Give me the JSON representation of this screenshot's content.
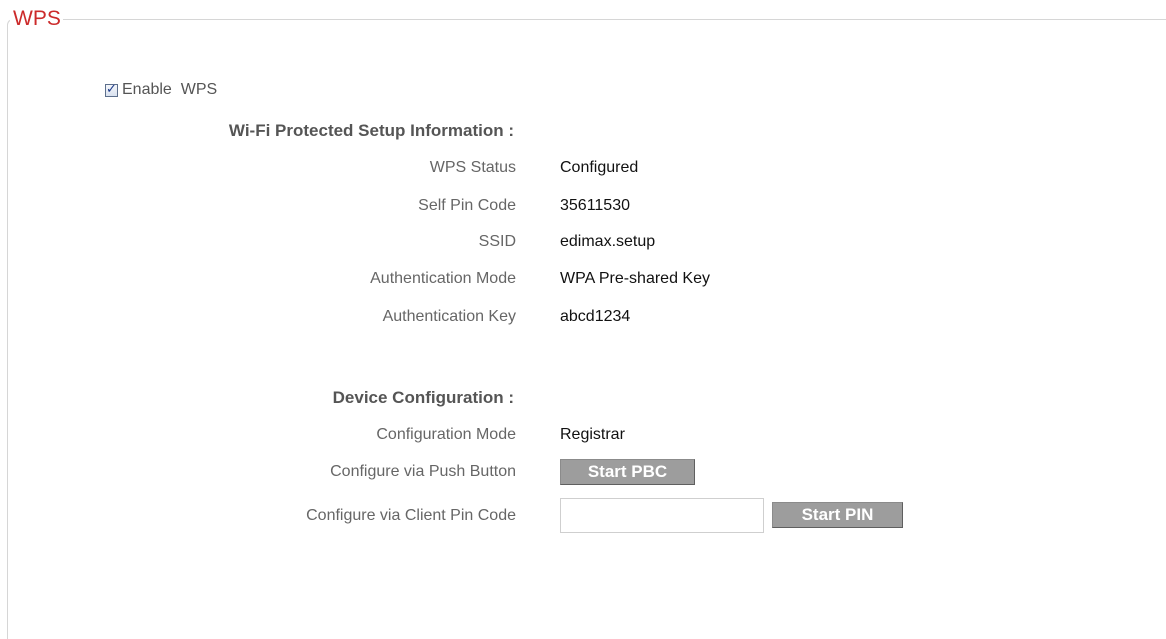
{
  "section": {
    "legend": "WPS"
  },
  "enable": {
    "label": "Enable  WPS",
    "checked": true
  },
  "info": {
    "title": "Wi-Fi Protected Setup Information :",
    "rows": [
      {
        "label": "WPS Status",
        "value": "Configured"
      },
      {
        "label": "Self Pin Code",
        "value": "35611530"
      },
      {
        "label": "SSID",
        "value": "edimax.setup"
      },
      {
        "label": "Authentication Mode",
        "value": "WPA Pre-shared Key"
      },
      {
        "label": "Authentication Key",
        "value": "abcd1234"
      }
    ]
  },
  "device": {
    "title": "Device Configuration :",
    "mode_label": "Configuration Mode",
    "mode_value": "Registrar",
    "pbc_label": "Configure via Push Button",
    "pbc_button": "Start PBC",
    "pin_label": "Configure via Client Pin Code",
    "pin_value": "",
    "pin_button": "Start PIN"
  },
  "colors": {
    "legend": "#cc2a2a",
    "button_bg": "#9d9d9d"
  }
}
